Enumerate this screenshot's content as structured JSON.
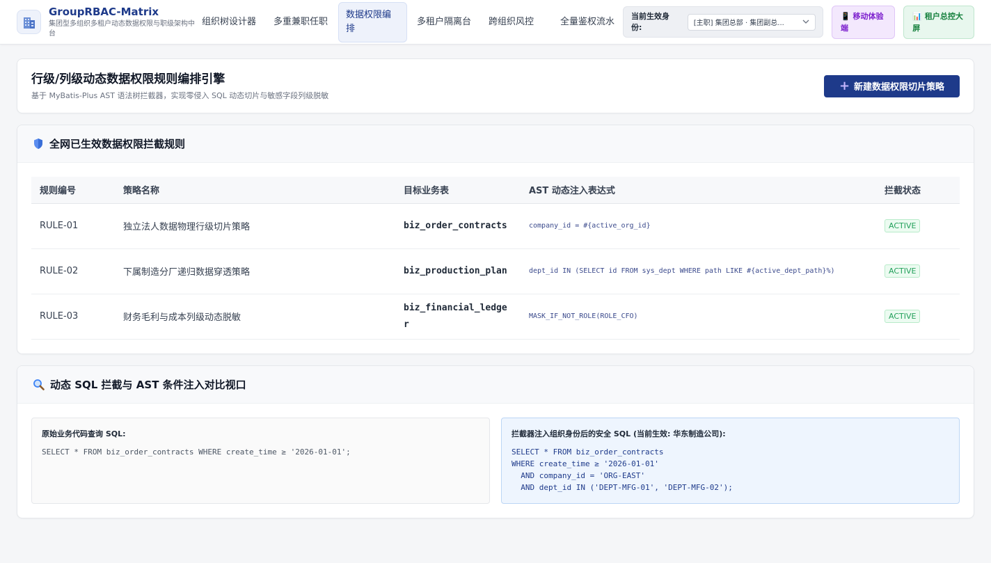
{
  "brand": {
    "title": "GroupRBAC-Matrix",
    "subtitle": "集团型多组织多租户动态数据权限与职级架构中台",
    "logo_icon": "building-icon"
  },
  "nav": [
    {
      "label": "组织树设计器",
      "active": false
    },
    {
      "label": "多重兼职任职",
      "active": false
    },
    {
      "label": "数据权限编排",
      "active": true
    },
    {
      "label": "多租户隔离台",
      "active": false
    },
    {
      "label": "跨组织风控",
      "active": false
    },
    {
      "label": "全量鉴权流水",
      "active": false
    }
  ],
  "identity": {
    "label": "当前生效身份:",
    "value": "[主职] 集团总部 · 集团副总..."
  },
  "actions": {
    "mobile": "📱 移动体验端",
    "screen": "📊 租户总控大屏"
  },
  "page": {
    "title": "行级/列级动态数据权限规则编排引擎",
    "subtitle": "基于 MyBatis-Plus AST 语法树拦截器，实现零侵入 SQL 动态切片与敏感字段列级脱敏",
    "new_button": "新建数据权限切片策略"
  },
  "rules_section": {
    "title": "全网已生效数据权限拦截规则",
    "columns": [
      "规则编号",
      "策略名称",
      "目标业务表",
      "AST 动态注入表达式",
      "拦截状态"
    ],
    "rows": [
      {
        "id": "RULE-01",
        "name": "独立法人数据物理行级切片策略",
        "table": "biz_order_contracts",
        "expr": "company_id = #{active_org_id}",
        "status": "ACTIVE"
      },
      {
        "id": "RULE-02",
        "name": "下属制造分厂递归数据穿透策略",
        "table": "biz_production_plan",
        "expr": "dept_id IN (SELECT id FROM sys_dept WHERE path LIKE #{active_dept_path}%)",
        "status": "ACTIVE"
      },
      {
        "id": "RULE-03",
        "name": "财务毛利与成本列级动态脱敏",
        "table": "biz_financial_ledger",
        "expr": "MASK_IF_NOT_ROLE(ROLE_CFO)",
        "status": "ACTIVE"
      }
    ]
  },
  "compare_section": {
    "title": "动态 SQL 拦截与 AST 条件注入对比视口",
    "original_label": "原始业务代码查询 SQL:",
    "original_sql": "SELECT * FROM biz_order_contracts WHERE create_time ≥ '2026-01-01';",
    "safe_label": "拦截器注入组织身份后的安全 SQL (当前生效: 华东制造公司):",
    "safe_sql": "SELECT * FROM biz_order_contracts\nWHERE create_time ≥ '2026-01-01'\n  AND company_id = 'ORG-EAST'\n  AND dept_id IN ('DEPT-MFG-01', 'DEPT-MFG-02');"
  },
  "colors": {
    "brand": "#1e3a8a",
    "active_badge": "#22a05a",
    "mobile_accent": "#7e22ce",
    "screen_accent": "#15803d"
  }
}
